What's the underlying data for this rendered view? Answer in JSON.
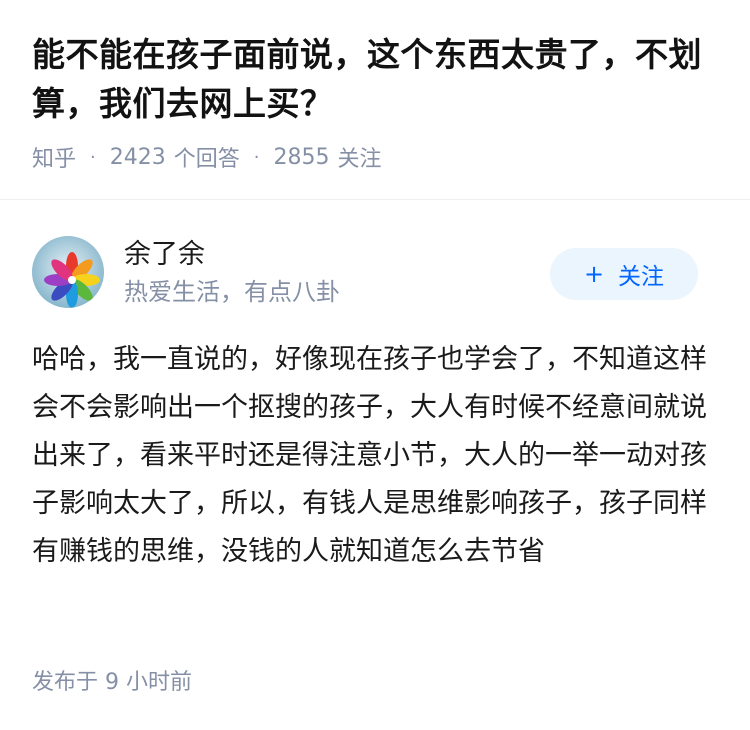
{
  "question": {
    "title": "能不能在孩子面前说，这个东西太贵了，不划算，我们去网上买？",
    "source": "知乎",
    "answer_count": "2423",
    "answer_label": "个回答",
    "follower_count": "2855",
    "follower_label": "关注"
  },
  "answer": {
    "author": {
      "name": "余了余",
      "bio": "热爱生活，有点八卦",
      "avatar": "pinwheel-avatar"
    },
    "follow_button": {
      "icon": "+",
      "label": "关注"
    },
    "content": "哈哈，我一直说的，好像现在孩子也学会了，不知道这样会不会影响出一个抠搜的孩子，大人有时候不经意间就说出来了，看来平时还是得注意小节，大人的一举一动对孩子影响太大了，所以，有钱人是思维影响孩子，孩子同样有赚钱的思维，没钱的人就知道怎么去节省",
    "publish_time": "发布于  9 小时前"
  },
  "colors": {
    "accent": "#0066ff",
    "follow_bg": "#ebf5fd",
    "meta_text": "#8590a6",
    "body_text": "#1a1a1a"
  }
}
